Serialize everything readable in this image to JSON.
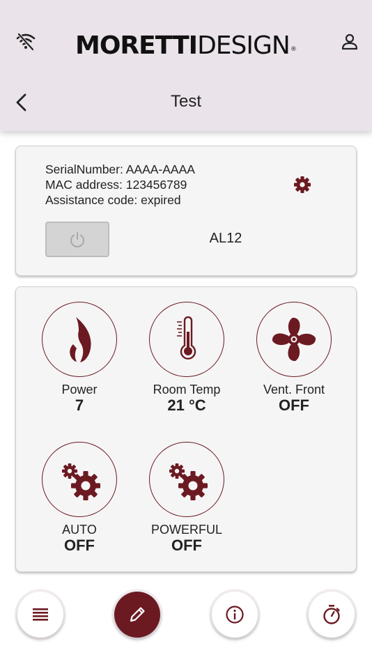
{
  "header": {
    "brand_bold": "MORETTI",
    "brand_light": "DESIGN",
    "brand_mark": "®",
    "title": "Test",
    "icons": {
      "wifi": "wifi-off-icon",
      "user": "user-icon",
      "back": "chevron-left-icon"
    }
  },
  "device": {
    "serial_line": "SerialNumber: AAAA-AAAA",
    "mac_line": "MAC address: 123456789",
    "assistance_line": "Assistance code: expired",
    "model": "AL12",
    "icons": {
      "settings": "gear-icon",
      "power": "power-icon"
    }
  },
  "tiles": [
    {
      "label": "Power",
      "value": "7",
      "icon": "flame-icon"
    },
    {
      "label": "Room Temp",
      "value": "21 °C",
      "icon": "thermometer-icon"
    },
    {
      "label": "Vent. Front",
      "value": "OFF",
      "icon": "fan-icon"
    },
    {
      "label": "AUTO",
      "value": "OFF",
      "icon": "gears-icon"
    },
    {
      "label": "POWERFUL",
      "value": "OFF",
      "icon": "gears-icon"
    }
  ],
  "bottom_nav": [
    {
      "icon": "list-icon"
    },
    {
      "icon": "pencil-icon",
      "active": true
    },
    {
      "icon": "info-icon"
    },
    {
      "icon": "timer-icon"
    }
  ],
  "colors": {
    "accent": "#6b1a22",
    "header_bg": "#eae4ea",
    "card_bg": "#f5f5f5"
  }
}
